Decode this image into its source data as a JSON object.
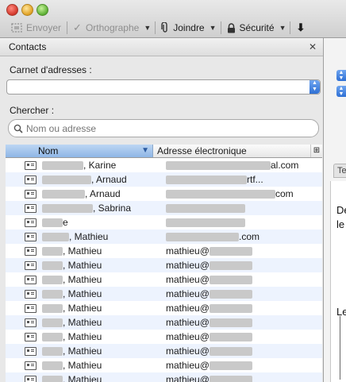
{
  "toolbar": {
    "send": "Envoyer",
    "spelling": "Orthographe",
    "attach": "Joindre",
    "security": "Sécurité"
  },
  "sidebar": {
    "title": "Contacts",
    "address_book_label": "Carnet d'adresses :",
    "address_book_value": "",
    "search_label": "Chercher :",
    "search_placeholder": "Nom ou adresse"
  },
  "table": {
    "columns": [
      "Nom",
      "Adresse électronique"
    ],
    "rows": [
      {
        "name": ", Karine",
        "email": "al.com"
      },
      {
        "name": ", Arnaud",
        "email": "rtf..."
      },
      {
        "name": ", Arnaud",
        "email": "com"
      },
      {
        "name": ", Sabrina",
        "email": ""
      },
      {
        "name": "e",
        "email": ""
      },
      {
        "name": ", Mathieu",
        "email": ".com"
      },
      {
        "name": ", Mathieu",
        "email": "mathieu@"
      },
      {
        "name": ", Mathieu",
        "email": "mathieu@"
      },
      {
        "name": ", Mathieu",
        "email": "mathieu@"
      },
      {
        "name": ", Mathieu",
        "email": "mathieu@"
      },
      {
        "name": ", Mathieu",
        "email": "mathieu@"
      },
      {
        "name": ", Mathieu",
        "email": "mathieu@"
      },
      {
        "name": ", Mathieu",
        "email": "mathieu@"
      },
      {
        "name": ", Mathieu",
        "email": "mathieu@"
      },
      {
        "name": ", Mathieu",
        "email": "mathieu@"
      },
      {
        "name": ", Mathieu",
        "email": "mathieu@"
      }
    ]
  },
  "compose_preview": {
    "tab_label": "Te",
    "line1": "De",
    "line2": "le",
    "line3": "Le"
  }
}
